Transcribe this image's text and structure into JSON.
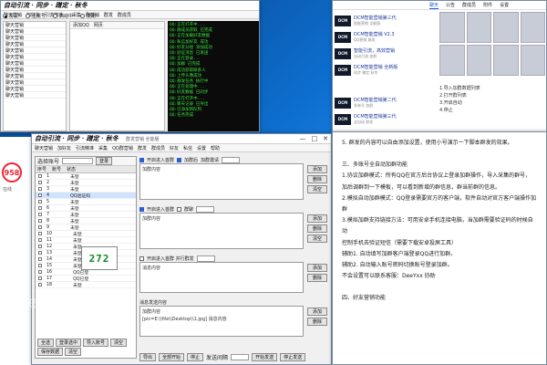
{
  "back_window": {
    "brand": "自动引流 · 同步 · 蹭定 · 秋冬",
    "menu": [
      "聊天营销",
      "加好友",
      "引流精准...",
      "采集",
      "群营销",
      "群发",
      "群成员"
    ],
    "radios": [
      "协议",
      "主账号",
      "启动中",
      "使用"
    ],
    "left_rows": [
      "聊天营销",
      "聊天营销",
      "聊天营销",
      "聊天营销",
      "聊天营销",
      "聊天营销",
      "聊天营销",
      "聊天营销",
      "聊天营销",
      "聊天营销",
      "聊天营销",
      "聊天营销"
    ],
    "mid_header": [
      "添加QQ",
      "网页"
    ],
    "console_lines": [
      "QQ:正在打开中...",
      "QQ:群成员获取 已完成",
      "QQ:正在加载好友数据",
      "QQ:私信加好友 成功",
      "QQ:好友分组 添加成功",
      "QQ:验证消息 已发送",
      "QQ:正在登录...",
      "QQ:加群 已完成",
      "QQ:成功获取联系人",
      "QQ:上传头像成功",
      "QQ:群发任务 执行中",
      "QQ:正在处理中...",
      "QQ:好友数据 已同步",
      "QQ:正在打开中...",
      "QQ:聊天记录 已导出",
      "QQ:已添加到队列",
      "QQ:任务完成"
    ]
  },
  "side_strip": {
    "badge": "958",
    "badge_sub": "在线"
  },
  "main_window": {
    "brand": "自动引流 · 同步 · 蹭定 · 秋冬",
    "subtitle": "群发营销 全能版",
    "menu": [
      "聊天营销",
      "加好友",
      "引流精准",
      "采集",
      "QQ群营销",
      "群发",
      "群成员",
      "好友",
      "私信",
      "设置",
      "帮助"
    ],
    "controls": [
      "—",
      "□",
      "✕"
    ],
    "select_label": "选择账号",
    "login_button": "登录",
    "list_header": [
      "序号",
      "账号",
      "状态"
    ],
    "accounts": [
      {
        "id": "1",
        "status": "未登"
      },
      {
        "id": "2",
        "status": "未登"
      },
      {
        "id": "3",
        "status": "未登"
      },
      {
        "id": "4",
        "status": "QQ验证码"
      },
      {
        "id": "5",
        "status": "未登"
      },
      {
        "id": "6",
        "status": "未登"
      },
      {
        "id": "7",
        "status": "未登"
      },
      {
        "id": "8",
        "status": "未登"
      },
      {
        "id": "9",
        "status": "未登"
      },
      {
        "id": "10",
        "status": "未登"
      },
      {
        "id": "11",
        "status": "未登"
      },
      {
        "id": "12",
        "status": "未登"
      },
      {
        "id": "13",
        "status": "未登"
      },
      {
        "id": "14",
        "status": "未登"
      },
      {
        "id": "15",
        "status": "未登"
      },
      {
        "id": "16",
        "status": "QQ已登"
      },
      {
        "id": "17",
        "status": "QQ已登"
      },
      {
        "id": "18",
        "status": "未登"
      }
    ],
    "captcha": "272",
    "bottom_buttons": [
      "全选",
      "登录选中",
      "导入账号",
      "清空"
    ],
    "bottom_inputs": [
      "保存数据",
      "清空"
    ],
    "opt1": {
      "check": "开启进入首群",
      "check2": "加群后",
      "label": "加群邀请",
      "area": "加群内容"
    },
    "opt2": {
      "check": "开启进入首群",
      "check2": "群聊",
      "area": "加群内容"
    },
    "opt3": {
      "check": "开启进入首群 并行群发",
      "area": "消息内容"
    },
    "opt4": {
      "label": "消息发送内容",
      "area": "加群内容",
      "area2": "[pic=E:\\\\file\\\\Desktop\\\\1.jpg] 消息内容"
    },
    "side_buttons": [
      "添加",
      "删除",
      "清空"
    ],
    "footer": [
      "导出",
      "全部开始",
      "停止",
      "发送间隔",
      "开始发送",
      "停止发送"
    ]
  },
  "doc_window": {
    "lines": [
      "5. 群发的内容可以自由添加设置，使用小号演示一下脚本群发的效果。",
      "",
      "三、多账号全自动加群功能",
      "1.协议加群模式：所有QQ在官方后台协议上登录加群操作，导入采集的群号，",
      "  加后调群到一下模板，可以看到新增的群信息，群当前群的信息。",
      "2.模拟自动加群模式：QQ登录需要官方的客户端，软件自动对官方客户端操作加群",
      "3.模拟加群支持链接方法：可用安卓手机连接电脑，当加群需要验证码的时候自动",
      "  控制手机去验证短信（需要下载安卓投屏工具）",
      "  辅助1. 自动填写加群客户端登录QQ进行加群。",
      "  辅助2. 自动输入账号密码切换账号登录加群。",
      "  不会设置可以联系客服：DeeYxx 协助",
      "",
      "四、好友营销功能"
    ]
  },
  "browser_window": {
    "tabs": [
      "聊天",
      "公告",
      "群成员",
      "附件",
      "设置"
    ],
    "news": [
      {
        "thumb": "DCM",
        "title": "DCM智能营销第三代",
        "sub": "智能营销 全能版"
      },
      {
        "thumb": "DCM",
        "title": "DCM智能营销 V2.3",
        "sub": "QQ营销 群发"
      },
      {
        "thumb": "DCM",
        "title": "智能引流，高效营销",
        "sub": "自动引流 加群"
      },
      {
        "thumb": "DCM",
        "title": "DCM智能营销 全新版",
        "sub": "同步 蹭定 秋冬"
      },
      {
        "thumb": "",
        "title": "",
        "sub": ""
      },
      {
        "thumb": "DCM",
        "title": "DCM智能营销第二代",
        "sub": "多账号 加群"
      },
      {
        "thumb": "DCM",
        "title": "DCM智能营销第三代",
        "sub": "全自动 群发"
      }
    ],
    "right_list": [
      "1.导入加群数据列表",
      "2.打开群列表",
      "3.开启自动",
      "4.停止"
    ]
  },
  "watermark": "DeeYxx"
}
